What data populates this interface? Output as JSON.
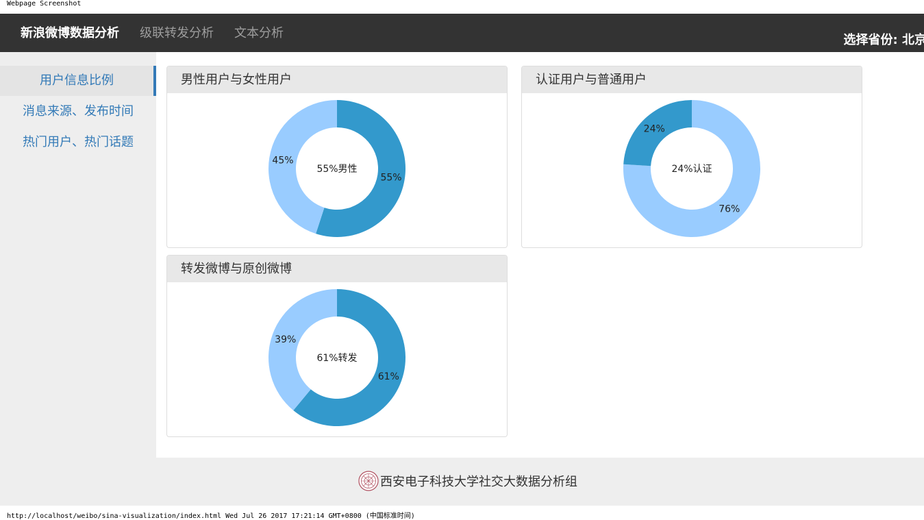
{
  "page": {
    "screenshot_label": "Webpage Screenshot",
    "status_line": "http://localhost/weibo/sina-visualization/index.html Wed Jul 26 2017 17:21:14 GMT+0800 (中国标准时间)"
  },
  "navbar": {
    "brand": "新浪微博数据分析",
    "links": [
      "级联转发分析",
      "文本分析"
    ],
    "province": "选择省份: 北京"
  },
  "sidebar": {
    "items": [
      {
        "label": "用户信息比例",
        "active": true
      },
      {
        "label": "消息来源、发布时间",
        "active": false
      },
      {
        "label": "热门用户、热门话题",
        "active": false
      }
    ]
  },
  "colors": {
    "dark_slice": "#3399cc",
    "light_slice": "#99ccff",
    "accent": "#337ab7"
  },
  "chart_data": [
    {
      "type": "pie",
      "title": "男性用户与女性用户",
      "center_label": "55%男性",
      "slices": [
        {
          "value": 55,
          "label": "55%",
          "color": "#3399cc"
        },
        {
          "value": 45,
          "label": "45%",
          "color": "#99ccff"
        }
      ]
    },
    {
      "type": "pie",
      "title": "认证用户与普通用户",
      "center_label": "24%认证",
      "slices": [
        {
          "value": 76,
          "label": "76%",
          "color": "#99ccff"
        },
        {
          "value": 24,
          "label": "24%",
          "color": "#3399cc"
        }
      ]
    },
    {
      "type": "pie",
      "title": "转发微博与原创微博",
      "center_label": "61%转发",
      "slices": [
        {
          "value": 61,
          "label": "61%",
          "color": "#3399cc"
        },
        {
          "value": 39,
          "label": "39%",
          "color": "#99ccff"
        }
      ]
    }
  ],
  "footer": {
    "logo": "university-seal-icon",
    "text": "西安电子科技大学社交大数据分析组"
  }
}
